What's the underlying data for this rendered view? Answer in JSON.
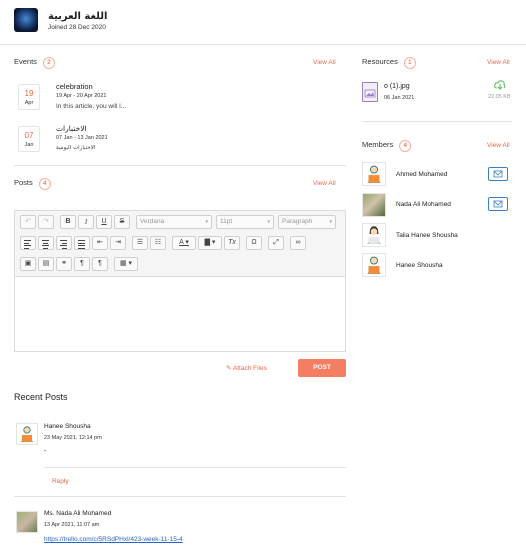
{
  "group": {
    "title": "اللغة العربية",
    "joined": "Joined 28 Dec 2020"
  },
  "events": {
    "title": "Events",
    "count": "2",
    "view_all": "View All",
    "items": [
      {
        "day": "19",
        "month": "Apr",
        "title": "celebration",
        "date": "19 Apr - 20 Apr 2021",
        "desc": "In this article, you will l..."
      },
      {
        "day": "07",
        "month": "Jan",
        "title": "الاختبارات",
        "date": "07 Jan - 13 Jan 2021",
        "desc": "الاختبارات اليومية"
      }
    ]
  },
  "posts": {
    "title": "Posts",
    "count": "4",
    "view_all": "View All",
    "editor": {
      "font": "Verdana",
      "size": "11pt",
      "format": "Paragraph"
    },
    "attach_label": "Attach Files",
    "post_label": "POST"
  },
  "recent": {
    "title": "Recent Posts",
    "items": [
      {
        "author": "Hanee Shousha",
        "time": "23 May 2021, 12:14 pm",
        "body": "-",
        "reply": "Reply"
      },
      {
        "author": "Ms. Nada Ali Mohamed",
        "time": "13 Apr 2021, 11:07 am",
        "link": "https://trello.com/c/5RSdPHxl/423-week-11-15-4"
      }
    ]
  },
  "resources": {
    "title": "Resources",
    "count": "1",
    "view_all": "View All",
    "file": {
      "name": "o (1).jpg",
      "date": "06 Jan 2021",
      "size": "22.05 KB"
    }
  },
  "members": {
    "title": "Members",
    "count": "4",
    "view_all": "View All",
    "items": [
      {
        "name": "Ahmed Mohamed"
      },
      {
        "name": "Nada Ali Mohamed"
      },
      {
        "name": "Talia Hanee Shousha"
      },
      {
        "name": "Hanee Shousha"
      }
    ]
  },
  "colors": {
    "accent": "#e8684a",
    "post_button": "#f47d62",
    "link": "#2a63c6"
  }
}
